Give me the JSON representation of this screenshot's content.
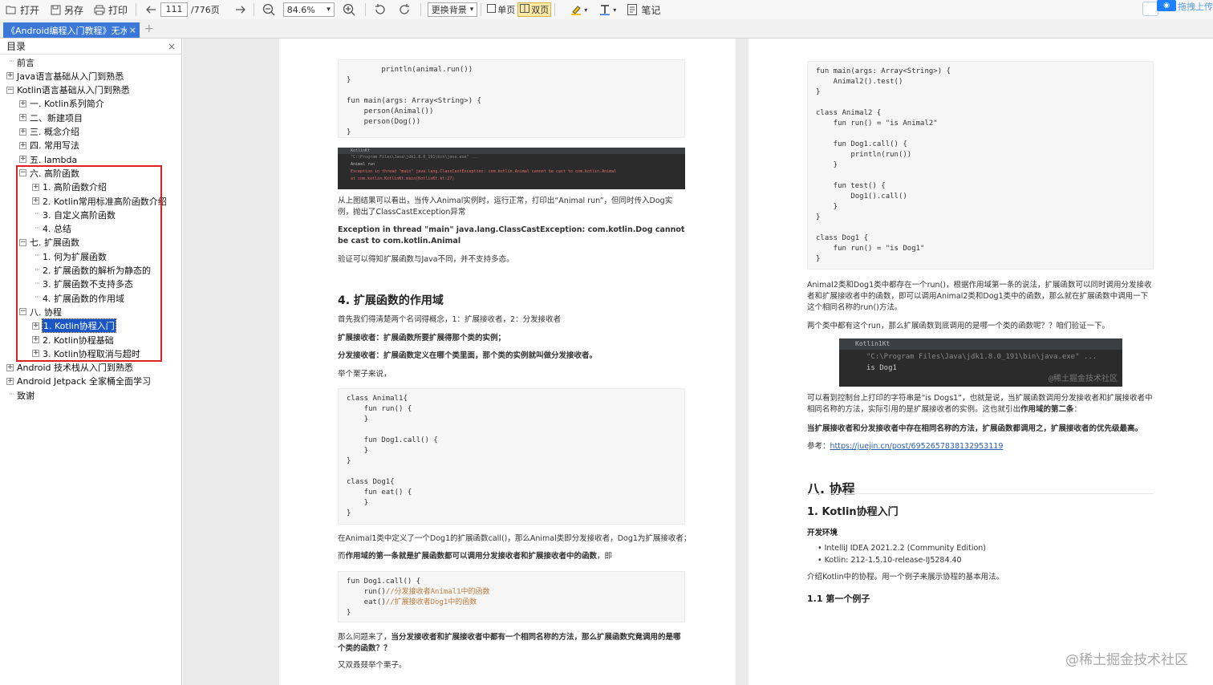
{
  "toolbar": {
    "open": "打开",
    "save_as": "另存",
    "print": "打印",
    "page_current": "111",
    "page_total": "/776页",
    "zoom": "84.6%",
    "background_select": "更换背景",
    "single_page": "单页",
    "double_page": "双页",
    "notes": "笔记",
    "upload": "拖拽上传"
  },
  "tab": {
    "title": "《Android编程入门教程》无水印",
    "new_tab": "+"
  },
  "sidebar": {
    "title": "目录",
    "close": "×",
    "items": [
      {
        "label": "前言",
        "level": 0,
        "expander": "none"
      },
      {
        "label": "Java语言基础从入门到熟悉",
        "level": 0,
        "expander": "+"
      },
      {
        "label": "Kotlin语言基础从入门到熟悉",
        "level": 0,
        "expander": "-"
      },
      {
        "label": "一. Kotlin系列简介",
        "level": 1,
        "expander": "+"
      },
      {
        "label": "二、新建项目",
        "level": 1,
        "expander": "+"
      },
      {
        "label": "三. 概念介绍",
        "level": 1,
        "expander": "+"
      },
      {
        "label": "四. 常用写法",
        "level": 1,
        "expander": "+"
      },
      {
        "label": "五. lambda",
        "level": 1,
        "expander": "+"
      },
      {
        "label": "六. 高阶函数",
        "level": 1,
        "expander": "-"
      },
      {
        "label": "1. 高阶函数介绍",
        "level": 2,
        "expander": "+"
      },
      {
        "label": "2. Kotlin常用标准高阶函数介绍",
        "level": 2,
        "expander": "+"
      },
      {
        "label": "3. 自定义高阶函数",
        "level": 2,
        "expander": "none"
      },
      {
        "label": "4. 总结",
        "level": 2,
        "expander": "none"
      },
      {
        "label": "七. 扩展函数",
        "level": 1,
        "expander": "-"
      },
      {
        "label": "1. 何为扩展函数",
        "level": 2,
        "expander": "none"
      },
      {
        "label": "2. 扩展函数的解析为静态的",
        "level": 2,
        "expander": "none"
      },
      {
        "label": "3. 扩展函数不支持多态",
        "level": 2,
        "expander": "none"
      },
      {
        "label": "4. 扩展函数的作用域",
        "level": 2,
        "expander": "none"
      },
      {
        "label": "八. 协程",
        "level": 1,
        "expander": "-"
      },
      {
        "label": "1. Kotlin协程入门",
        "level": 2,
        "expander": "+",
        "selected": true
      },
      {
        "label": "2. Kotlin协程基础",
        "level": 2,
        "expander": "+"
      },
      {
        "label": "3. Kotlin协程取消与超时",
        "level": 2,
        "expander": "+"
      },
      {
        "label": "Android 技术栈从入门到熟悉",
        "level": 0,
        "expander": "+"
      },
      {
        "label": "Android Jetpack 全家桶全面学习",
        "level": 0,
        "expander": "+"
      },
      {
        "label": "致谢",
        "level": 0,
        "expander": "none"
      }
    ]
  },
  "left_page": {
    "code1": "        println(animal.run())\n}\n\nfun main(args: Array<String>) {\n    person(Animal())\n    person(Dog())\n}",
    "term1_title": "KotlinKt",
    "term1_line1": "\"C:\\Program Files\\Java\\jdk1.8.0_191\\bin\\java.exe\" ...",
    "term1_line2": "Animal run",
    "term1_line3": "Exception in thread \"main\" java.lang.ClassCastException: com.kotlin.Animal cannot be cast to com.kotlin.Animal",
    "term1_line4": "    at com.kotlin.KotlinKt.main(KotlinKt.kt:27)",
    "para1": "从上图结果可以看出，当传入Animal实例时，运行正常，打印出“Animal run”，但同时传入Dog实例，抛出了ClassCastException异常",
    "para2": "Exception in thread \"main\" java.lang.ClassCastException: com.kotlin.Dog cannot be cast to com.kotlin.Animal",
    "para3": "验证可以得知扩展函数与Java不同，并不支持多态。",
    "heading": "4. 扩展函数的作用域",
    "para4": "首先我们得清楚两个名词得概念，1：扩展接收者，2：分发接收者",
    "para5": "扩展接收者：扩展函数所要扩展得那个类的实例；",
    "para6": "分发接收者：扩展函数定义在哪个类里面，那个类的实例就叫做分发接收者。",
    "para7": "举个栗子来说，",
    "code2": "class Animal1{\n    fun run() {\n    }\n\n    fun Dog1.call() {\n    }\n}\n\nclass Dog1{\n    fun eat() {\n    }\n}",
    "para8": "在Animal1类中定义了一个Dog1的扩展函数call()，那么Animal类即分发接收者，Dog1为扩展接收者；",
    "para9_prefix": "而",
    "para9": "作用域的第一条就是扩展函数都可以调用分发接收者和扩展接收者中的函数",
    "para9_suffix": "，即",
    "code3_l1": "fun Dog1.call() {",
    "code3_l2": "    run()",
    "code3_c2": "//分发接收者Animal1中的函数",
    "code3_l3": "    eat()",
    "code3_c3": "//扩展接收者Dog1中的函数",
    "code3_l4": "}",
    "para10_prefix": "那么问题来了，",
    "para10": "当分发接收者和扩展接收者中都有一个相同名称的方法，那么扩展函数究竟调用的是哪个类的函数？？",
    "para11": "又双叒叕举个栗子。"
  },
  "right_page": {
    "code1": "fun main(args: Array<String>) {\n    Animal2().test()\n}\n\nclass Animal2 {\n    fun run() = \"is Animal2\"\n\n    fun Dog1.call() {\n        println(run())\n    }\n\n    fun test() {\n        Dog1().call()\n    }\n}\n\nclass Dog1 {\n    fun run() = \"is Dog1\"\n}",
    "para1": "Animal2类和Dog1类中都存在一个run()，根据作用域第一条的说法，扩展函数可以同时调用分发接收者和扩展接收者中的函数，即可以调用Animal2类和Dog1类中的函数，那么就在扩展函数中调用一下这个相同名称的run()方法。",
    "para2": "两个类中都有这个run，那么扩展函数到底调用的是哪一个类的函数呢？？咱们验证一下。",
    "term_title": "Kotlin1Kt",
    "term_line1": "\"C:\\Program Files\\Java\\jdk1.8.0_191\\bin\\java.exe\" ...",
    "term_line2": "is Dog1",
    "term_watermark": "@稀土掘金技术社区",
    "para3": "可以看到控制台上打印的字符串是“is Dogs1”，也就是说，当扩展函数调用分发接收者和扩展接收者中相同名称的方法，实际引用的是扩展接收者的实例。这也就引出",
    "para3_bold": "作用域的第二条",
    "para3_end": "：",
    "para4": "当扩展接收者和分发接收者中存在相同名称的方法，扩展函数都调用之，扩展接收者的优先级最高。",
    "ref_label": "参考：",
    "ref_link": "https://juejin.cn/post/6952657838132953119",
    "h_chapter": "八. 协程",
    "h_section": "1. Kotlin协程入门",
    "dev_env": "开发环境",
    "bullets": [
      "IntelliJ IDEA 2021.2.2 (Community Edition)",
      "Kotlin: 212-1.5.10-release-IJ5284.40"
    ],
    "para5": "介绍Kotlin中的协程。用一个例子来展示协程的基本用法。",
    "h_sub": "1.1 第一个例子"
  },
  "watermark": "@稀土掘金技术社区",
  "colors": {
    "accent": "#3b78d8",
    "highlight_box": "#e02020",
    "selected_toc": "#1a56c8"
  }
}
